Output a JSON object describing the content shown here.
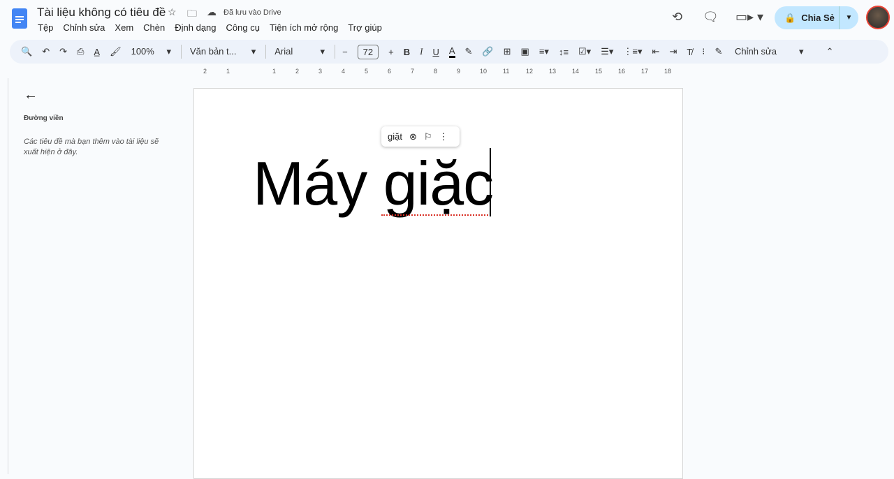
{
  "header": {
    "title": "Tài liệu không có tiêu đề",
    "saved_status": "Đã lưu vào Drive",
    "share_label": "Chia Sẻ"
  },
  "menu": [
    "Tệp",
    "Chỉnh sửa",
    "Xem",
    "Chèn",
    "Định dạng",
    "Công cụ",
    "Tiện ích mở rộng",
    "Trợ giúp"
  ],
  "toolbar": {
    "zoom": "100%",
    "style": "Văn bản t...",
    "font": "Arial",
    "font_size": "72",
    "mode": "Chỉnh sửa"
  },
  "ruler": {
    "labels": [
      "2",
      "1",
      "1",
      "2",
      "3",
      "4",
      "5",
      "6",
      "7",
      "8",
      "9",
      "10",
      "11",
      "12",
      "13",
      "14",
      "15",
      "16",
      "17",
      "18"
    ]
  },
  "sidebar": {
    "title": "Đường viền",
    "hint": "Các tiêu đề mà bạn thêm vào tài liệu sẽ xuất hiện ở đây."
  },
  "document": {
    "text": "Máy giặc"
  },
  "spell_popup": {
    "suggestion": "giặt"
  },
  "colors": {
    "accent": "#0b57d0",
    "share_bg": "#c2e7ff",
    "toolbar_bg": "#edf2fa"
  }
}
